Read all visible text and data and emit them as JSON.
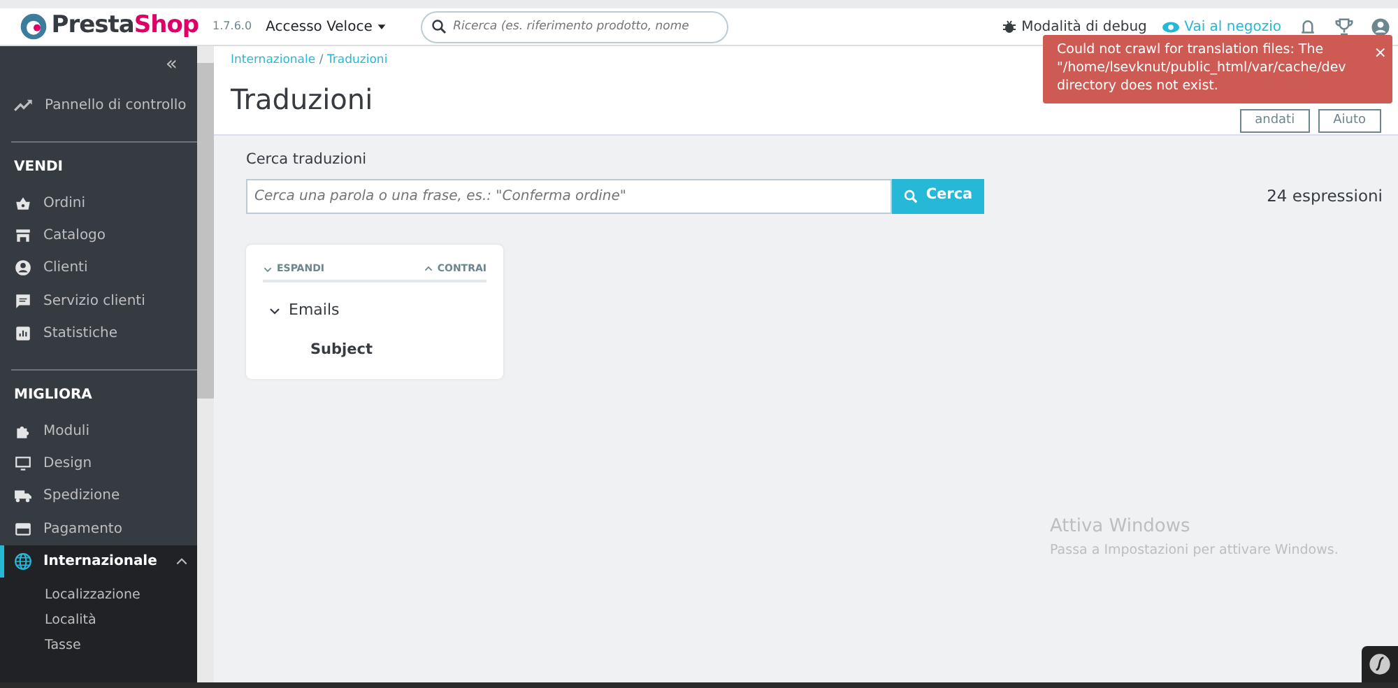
{
  "header": {
    "brand_parts": [
      "Presta",
      "Shop"
    ],
    "version": "1.7.6.0",
    "quick_access": "Accesso Veloce",
    "search": {
      "placeholder": "Ricerca (es. riferimento prodotto, nome"
    },
    "debug": "Modalità di debug",
    "shop_link": "Vai al negozio"
  },
  "sidebar": {
    "collapse": "«",
    "dashboard": "Pannello di controllo",
    "sections": [
      {
        "title": "VENDI",
        "items": [
          {
            "label": "Ordini",
            "selected": false
          },
          {
            "label": "Catalogo",
            "selected": false
          },
          {
            "label": "Clienti",
            "selected": false
          },
          {
            "label": "Servizio clienti",
            "selected": false
          },
          {
            "label": "Statistiche",
            "selected": false
          }
        ]
      },
      {
        "title": "MIGLIORA",
        "items": [
          {
            "label": "Moduli",
            "selected": false
          },
          {
            "label": "Design",
            "selected": false
          },
          {
            "label": "Spedizione",
            "selected": false
          },
          {
            "label": "Pagamento",
            "selected": false
          },
          {
            "label": "Internazionale",
            "selected": true,
            "expanded": true,
            "children": [
              {
                "label": "Localizzazione"
              },
              {
                "label": "Località"
              },
              {
                "label": "Tasse"
              }
            ]
          }
        ]
      }
    ]
  },
  "breadcrumb": {
    "separator": "/",
    "items": [
      "Internazionale",
      "Traduzioni"
    ]
  },
  "page_title": "Traduzioni",
  "toolbar_buttons": [
    "andati",
    "Aiuto"
  ],
  "toast": {
    "message": "Could not crawl for translation files: The\n\"/home/lsevknut/public_html/var/cache/dev\ndirectory does not exist.",
    "close": "×"
  },
  "search": {
    "label": "Cerca traduzioni",
    "placeholder": "Cerca una parola o una frase, es.: \"Conferma ordine\"",
    "button": "Cerca",
    "count": "24 espressioni"
  },
  "tree": {
    "expand_label": "ESPANDI",
    "collapse_label": "CONTRAI",
    "nodes": [
      {
        "label": "Emails",
        "expanded": true,
        "children": [
          {
            "label": "Subject"
          }
        ]
      }
    ]
  },
  "os_notice": {
    "title": "Attiva Windows",
    "text": "Passa a Impostazioni per attivare Windows."
  }
}
